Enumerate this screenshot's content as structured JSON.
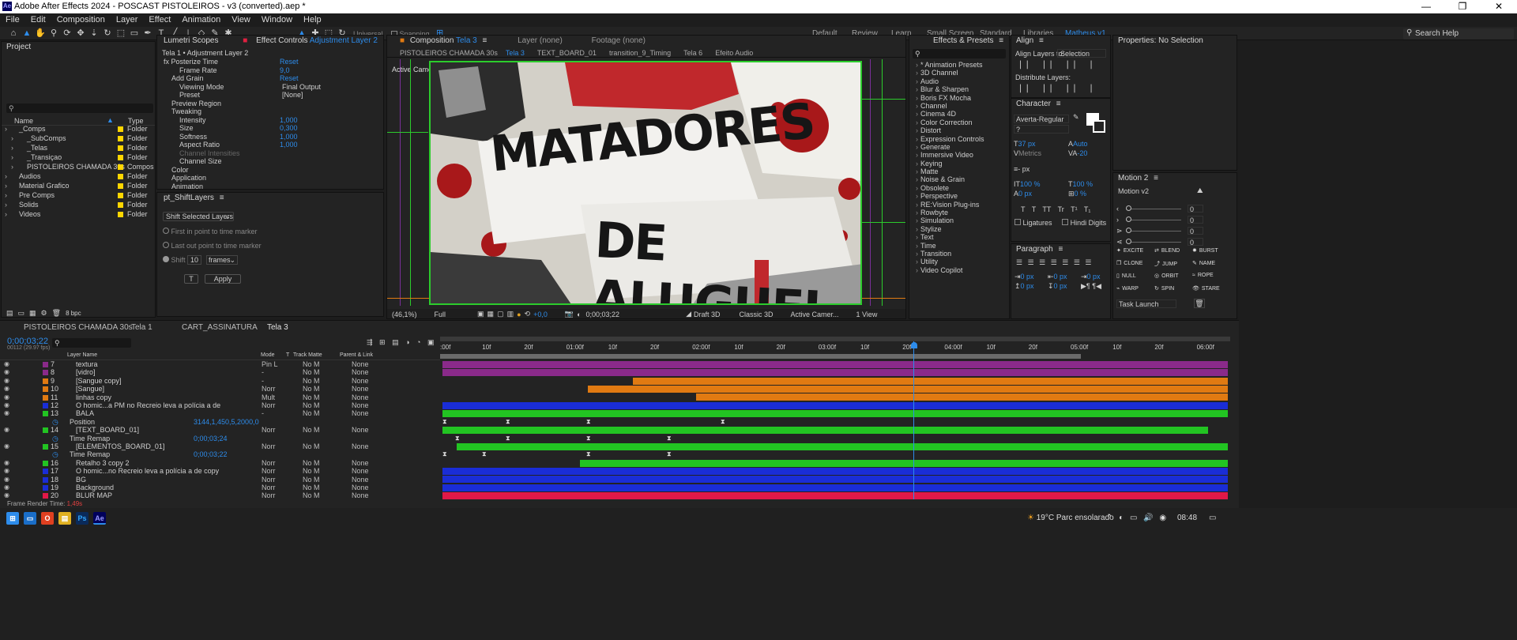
{
  "window": {
    "title": "Adobe After Effects 2024 - POSCAST PISTOLEIROS - v3 (converted).aep *",
    "logo_text": "Ae",
    "min": "—",
    "max": "❐",
    "close": "✕"
  },
  "menu": [
    "File",
    "Edit",
    "Composition",
    "Layer",
    "Effect",
    "Animation",
    "View",
    "Window",
    "Help"
  ],
  "toolbar": {
    "universal": "Universal",
    "snapping": "Snapping",
    "workspaces": [
      "Default",
      "Review",
      "Learn",
      "Small Screen",
      "Standard",
      "Libraries",
      "Matheus v1"
    ],
    "search_help": "Search Help"
  },
  "project": {
    "title": "Project",
    "col_name": "Name",
    "col_type": "Type",
    "items": [
      {
        "name": "_Comps",
        "type": "Folder",
        "indent": 0
      },
      {
        "name": "_SubComps",
        "type": "Folder",
        "indent": 1
      },
      {
        "name": "_Telas",
        "type": "Folder",
        "indent": 1
      },
      {
        "name": "_Transiçao",
        "type": "Folder",
        "indent": 1
      },
      {
        "name": "PISTOLEIROS CHAMADA 30s",
        "type": "Compos",
        "indent": 1
      },
      {
        "name": "Audios",
        "type": "Folder",
        "indent": 0
      },
      {
        "name": "Material Grafico",
        "type": "Folder",
        "indent": 0
      },
      {
        "name": "Pre Comps",
        "type": "Folder",
        "indent": 0
      },
      {
        "name": "Solids",
        "type": "Folder",
        "indent": 0
      },
      {
        "name": "Videos",
        "type": "Folder",
        "indent": 0
      }
    ],
    "bpc": "8 bpc"
  },
  "effect_controls": {
    "tab_lumetri": "Lumetri Scopes",
    "tab_title": "Effect Controls",
    "tab_layer": "Adjustment Layer 2",
    "header": "Tela 1 • Adjustment Layer 2",
    "rows": [
      {
        "label": "fx  Posterize Time",
        "value": "Reset",
        "indent": 0
      },
      {
        "label": "Frame Rate",
        "value": "9,0",
        "indent": 2
      },
      {
        "label": "Add Grain",
        "value": "Reset",
        "indent": 1
      },
      {
        "label": "Viewing Mode",
        "dropdown": "Final Output",
        "indent": 2
      },
      {
        "label": "Preset",
        "dropdown": "[None]",
        "indent": 2
      },
      {
        "label": "Preview Region",
        "indent": 1
      },
      {
        "label": "Tweaking",
        "indent": 1
      },
      {
        "label": "Intensity",
        "value": "1,000",
        "indent": 2
      },
      {
        "label": "Size",
        "value": "0,300",
        "indent": 2
      },
      {
        "label": "Softness",
        "value": "1,000",
        "indent": 2
      },
      {
        "label": "Aspect Ratio",
        "value": "1,000",
        "indent": 2
      },
      {
        "label": "Channel Intensities",
        "indent": 2,
        "dim": true
      },
      {
        "label": "Channel Size",
        "indent": 2
      },
      {
        "label": "Color",
        "indent": 1
      },
      {
        "label": "Application",
        "indent": 1
      },
      {
        "label": "Animation",
        "indent": 1
      }
    ]
  },
  "shift_layers": {
    "title": "pt_ShiftLayers",
    "mode": "Shift Selected Layers",
    "first": "First in point to time marker",
    "last": "Last out point to time marker",
    "shift_label": "Shift",
    "shift_value": "10",
    "unit": "frames",
    "t_button": "T",
    "apply": "Apply"
  },
  "composition": {
    "tab_title": "Composition",
    "tab_name": "Tela 3",
    "layer_tab": "Layer (none)",
    "footage_tab": "Footage (none)",
    "breadcrumb": [
      "PISTOLEIROS CHAMADA 30s",
      "Tela 3",
      "TEXT_BOARD_01",
      "transition_9_Timing",
      "Tela 6",
      "Efeito Audio"
    ],
    "camera_label": "Active Camera (Camera)",
    "headline1": "MATADORES",
    "headline2": "DE ALUGUEL",
    "zoom": "(46,1%)",
    "resolution": "Full",
    "exposure": "+0,0",
    "timecode": "0;00;03;22",
    "renderer": "Draft 3D",
    "classic": "Classic 3D",
    "camera": "Active Camer...",
    "view": "1 View"
  },
  "effects_presets": {
    "title": "Effects & Presets",
    "items": [
      "* Animation Presets",
      "3D Channel",
      "Audio",
      "Blur & Sharpen",
      "Boris FX Mocha",
      "Channel",
      "Cinema 4D",
      "Color Correction",
      "Distort",
      "Expression Controls",
      "Generate",
      "Immersive Video",
      "Keying",
      "Matte",
      "Noise & Grain",
      "Obsolete",
      "Perspective",
      "RE:Vision Plug-ins",
      "Rowbyte",
      "Simulation",
      "Stylize",
      "Text",
      "Time",
      "Transition",
      "Utility",
      "Video Copilot"
    ]
  },
  "align": {
    "title": "Align",
    "align_to": "Align Layers to:",
    "selection": "Selection",
    "distribute": "Distribute Layers:"
  },
  "character": {
    "title": "Character",
    "font": "Averta-Regular",
    "size": "37 px",
    "leading": "Auto",
    "tracking": "-20",
    "metrics": "Metrics",
    "stroke": "- px",
    "vscale": "100 %",
    "hscale": "100 %",
    "baseline": "0 px",
    "tsume": "0 %",
    "styles": [
      "T",
      "T",
      "TT",
      "Tr",
      "T¹",
      "T₁"
    ],
    "ligatures": "Ligatures",
    "hindi": "Hindi Digits"
  },
  "paragraph": {
    "title": "Paragraph",
    "vals": [
      "0 px",
      "0 px",
      "0 px",
      "0 px",
      "0 px"
    ]
  },
  "properties": {
    "title": "Properties: No Selection"
  },
  "motion": {
    "title": "Motion 2",
    "version": "Motion v2",
    "values": [
      "0",
      "0",
      "0",
      "0"
    ],
    "buttons": [
      "EXCITE",
      "BLEND",
      "BURST",
      "CLONE",
      "JUMP",
      "NAME",
      "NULL",
      "ORBIT",
      "ROPE",
      "WARP",
      "SPIN",
      "STARE"
    ],
    "task": "Task Launch"
  },
  "timeline": {
    "tabs": [
      "PISTOLEIROS CHAMADA 30s",
      "Tela 1",
      "CART_ASSINATURA",
      "Tela 3"
    ],
    "current_time": "0;00;03;22",
    "fps": "00112 (29.97 fps)",
    "col_layer": "Layer Name",
    "col_mode": "Mode",
    "col_t": "T",
    "col_trackmatte": "Track Matte",
    "col_parent": "Parent & Link",
    "ruler": [
      ":00f",
      "10f",
      "20f",
      "01:00f",
      "10f",
      "20f",
      "02:00f",
      "10f",
      "20f",
      "03:00f",
      "10f",
      "20f",
      "04:00f",
      "10f",
      "20f",
      "05:00f",
      "10f",
      "20f",
      "06:00f"
    ],
    "layers": [
      {
        "num": "7",
        "name": "textura",
        "mode": "Pin L",
        "tm": "No M",
        "parent": "None",
        "color": "#8a2a8a"
      },
      {
        "num": "8",
        "name": "[vidro]",
        "mode": "-",
        "tm": "No M",
        "parent": "None",
        "color": "#8a2a8a"
      },
      {
        "num": "9",
        "name": "[Sangue copy]",
        "mode": "-",
        "tm": "No M",
        "parent": "None",
        "color": "#e07a12"
      },
      {
        "num": "10",
        "name": "[Sangue]",
        "mode": "Norr",
        "tm": "No M",
        "parent": "None",
        "color": "#e07a12"
      },
      {
        "num": "11",
        "name": "linhas copy",
        "mode": "Mult",
        "tm": "No M",
        "parent": "None",
        "color": "#e07a12"
      },
      {
        "num": "12",
        "name": "O homic...a PM no Recreio leva a polícia a de",
        "mode": "Norr",
        "tm": "No M",
        "parent": "None",
        "color": "#1a2dd6"
      },
      {
        "num": "13",
        "name": "BALA",
        "mode": "-",
        "tm": "No M",
        "parent": "None",
        "color": "#22c422"
      },
      {
        "num": "",
        "name": "Position",
        "mode": "",
        "tm": "",
        "parent": "",
        "color": "",
        "value": "3144,1,450,5,2000,0"
      },
      {
        "num": "14",
        "name": "[TEXT_BOARD_01]",
        "mode": "Norr",
        "tm": "No M",
        "parent": "None",
        "color": "#22c422"
      },
      {
        "num": "",
        "name": "Time Remap",
        "mode": "",
        "tm": "",
        "parent": "",
        "color": "",
        "value": "0;00;03;24"
      },
      {
        "num": "15",
        "name": "[ELEMENTOS_BOARD_01]",
        "mode": "Norr",
        "tm": "No M",
        "parent": "None",
        "color": "#22c422"
      },
      {
        "num": "",
        "name": "Time Remap",
        "mode": "",
        "tm": "",
        "parent": "",
        "color": "",
        "value": "0;00;03;22"
      },
      {
        "num": "16",
        "name": "Retalho 3 copy 2",
        "mode": "Norr",
        "tm": "No M",
        "parent": "None",
        "color": "#22c422"
      },
      {
        "num": "17",
        "name": "O homic...no Recreio leva a polícia a de copy",
        "mode": "Norr",
        "tm": "No M",
        "parent": "None",
        "color": "#1a2dd6"
      },
      {
        "num": "18",
        "name": "BG",
        "mode": "Norr",
        "tm": "No M",
        "parent": "None",
        "color": "#1a2dd6"
      },
      {
        "num": "19",
        "name": "Background",
        "mode": "Norr",
        "tm": "No M",
        "parent": "None",
        "color": "#1a2dd6"
      },
      {
        "num": "20",
        "name": "BLUR MAP",
        "mode": "Norr",
        "tm": "No M",
        "parent": "None",
        "color": "#e01848"
      }
    ],
    "render_label": "Frame Render Time:",
    "render_time": "1,49s"
  },
  "taskbar": {
    "weather": "19°C  Parc ensolarado",
    "time": "08:48"
  }
}
